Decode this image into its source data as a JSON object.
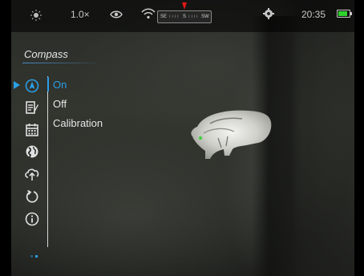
{
  "status": {
    "zoom": "1.0×",
    "time": "20:35",
    "compass": {
      "left": "SE",
      "center": "S",
      "right": "SW"
    },
    "battery_level": 0.85,
    "icons": [
      "brightness-icon",
      "eye-icon",
      "wifi-icon",
      "settings-gear-icon",
      "battery-icon"
    ]
  },
  "menu": {
    "title": "Compass",
    "items": [
      {
        "icon": "compass-icon",
        "selected": true
      },
      {
        "icon": "notes-icon"
      },
      {
        "icon": "calendar-icon"
      },
      {
        "icon": "globe-icon"
      },
      {
        "icon": "cloud-upload-icon"
      },
      {
        "icon": "reset-icon"
      },
      {
        "icon": "info-icon"
      }
    ],
    "options": [
      "On",
      "Off",
      "Calibration"
    ],
    "selected_option": "On"
  },
  "colors": {
    "accent": "#2a9fe6",
    "battery": "#2ed12e",
    "needle": "#e01818",
    "text": "#e6e6e6"
  }
}
